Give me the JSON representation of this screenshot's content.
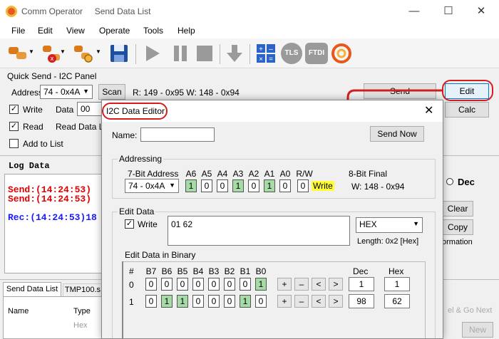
{
  "window": {
    "app_title": "Comm Operator",
    "doc_title": "Send Data List",
    "minimize": "—",
    "maximize": "☐",
    "close": "✕"
  },
  "menu": [
    "File",
    "Edit",
    "View",
    "Operate",
    "Tools",
    "Help"
  ],
  "toolbar": {
    "icons": [
      "connect-icon",
      "disconnect-icon",
      "settings-icon",
      "save-icon",
      "play-icon",
      "pause-icon",
      "stop-icon",
      "download-icon",
      "calculator-icon",
      "tls-icon",
      "ftdi-icon",
      "at-icon"
    ],
    "tls": "TLS",
    "ftdi": "FTDI"
  },
  "quick_send": {
    "title": "Quick Send - I2C Panel",
    "address_label": "Address",
    "address_value": "74 - 0x4A",
    "scan_label": "Scan",
    "rw_info": "R: 149 - 0x95  W: 148 - 0x94",
    "write_label": "Write",
    "data_label": "Data",
    "data_value": "00",
    "read_label": "Read",
    "read_data_label": "Read Data Le",
    "add_to_list_label": "Add to List",
    "send_label": "Send",
    "edit_label": "Edit",
    "calc_label": "Calc"
  },
  "log": {
    "title": "Log Data",
    "lines": [
      {
        "text": "Send:(14:24:53)",
        "color": "#e00000"
      },
      {
        "text": "Send:(14:24:53)",
        "color": "#e00000"
      },
      {
        "text": "Rec:(14:24:53)18",
        "color": "#1a1aff"
      }
    ],
    "dec_label": "Dec",
    "clear_label": "Clear",
    "copy_label": "Copy",
    "information_label": "ormation"
  },
  "bottom_tabs": {
    "tabs": [
      "Send Data List",
      "TMP100.s"
    ],
    "col_name": "Name",
    "col_type": "Type",
    "row_type": "Hex",
    "right_button": "New",
    "right_partial": "el & Go Next"
  },
  "dialog": {
    "title": "I2C Data Editor",
    "close": "✕",
    "name_label": "Name:",
    "name_value": "",
    "send_now_label": "Send Now",
    "addressing": {
      "title": "Addressing",
      "seven_bit_label": "7-Bit Address",
      "address_value": "74 - 0x4A",
      "bit_labels": [
        "A6",
        "A5",
        "A4",
        "A3",
        "A2",
        "A1",
        "A0",
        "R/W"
      ],
      "bits": [
        "1",
        "0",
        "0",
        "1",
        "0",
        "1",
        "0",
        "0"
      ],
      "rw_text": "Write",
      "eight_bit_label": "8-Bit Final",
      "eight_bit_value": "W: 148 - 0x94"
    },
    "edit_data": {
      "title": "Edit Data",
      "write_label": "Write",
      "data_value": "01 62",
      "format_value": "HEX",
      "length_text": "Length:  0x2 [Hex]"
    },
    "binary": {
      "title": "Edit Data in Binary",
      "hash_label": "#",
      "bit_labels": [
        "B7",
        "B6",
        "B5",
        "B4",
        "B3",
        "B2",
        "B1",
        "B0"
      ],
      "dec_label": "Dec",
      "hex_label": "Hex",
      "rows": [
        {
          "index": "0",
          "bits": [
            "0",
            "0",
            "0",
            "0",
            "0",
            "0",
            "0",
            "1"
          ],
          "dec": "1",
          "hex": "1"
        },
        {
          "index": "1",
          "bits": [
            "0",
            "1",
            "1",
            "0",
            "0",
            "0",
            "1",
            "0"
          ],
          "dec": "98",
          "hex": "62"
        }
      ],
      "btn_plus": "+",
      "btn_minus": "–",
      "btn_left": "<",
      "btn_right": ">"
    }
  }
}
